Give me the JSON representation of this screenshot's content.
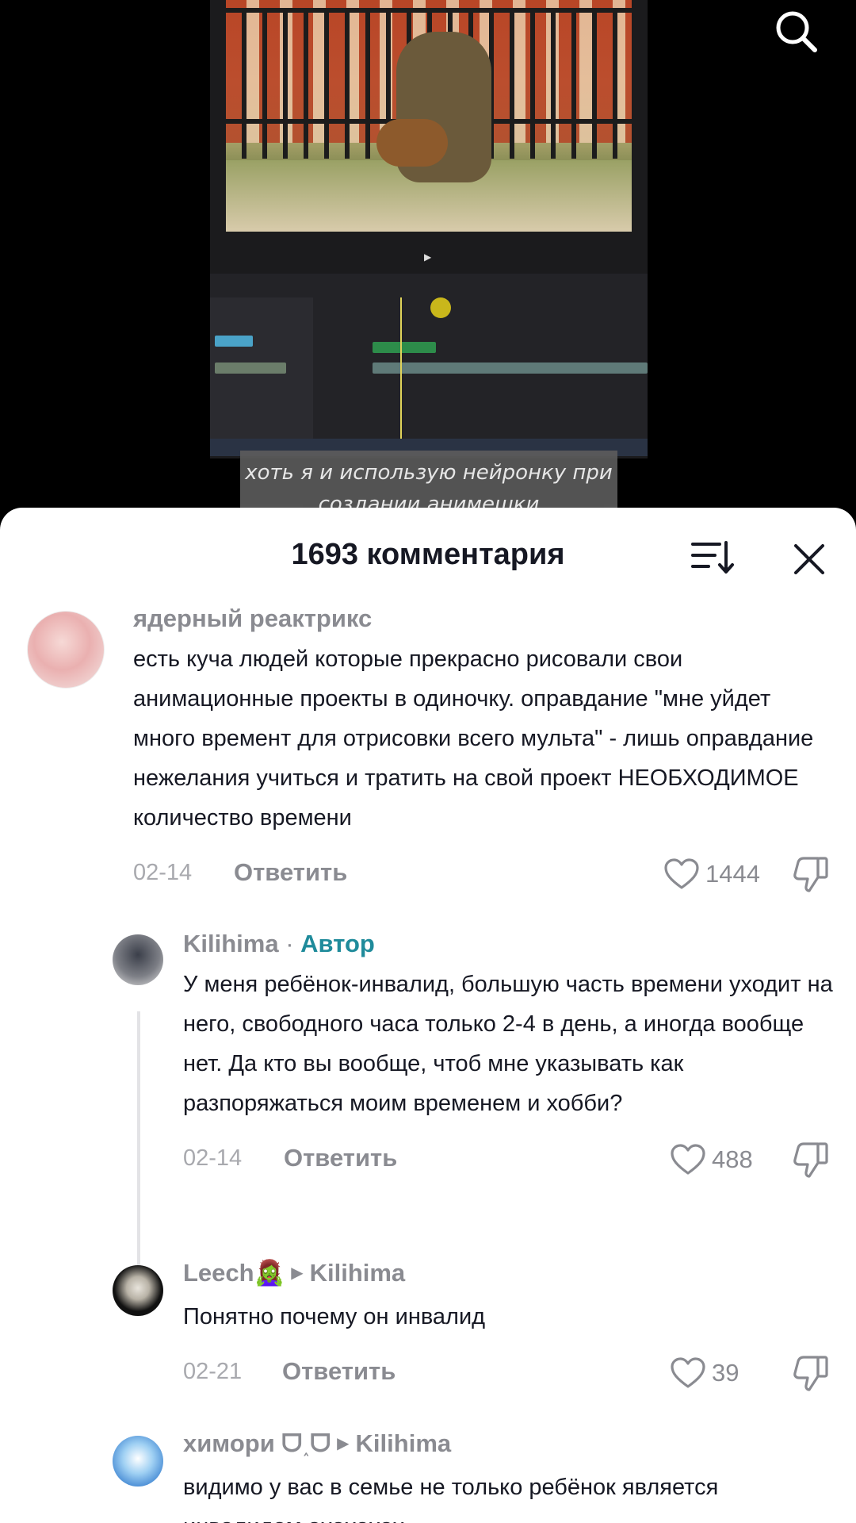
{
  "video": {
    "caption": "хоть я и использую нейронку при создании анимешки",
    "search_icon": "search-icon"
  },
  "sheet": {
    "title": "1693 комментария",
    "sort_icon": "sort-icon",
    "close_icon": "close-icon"
  },
  "comments": [
    {
      "author": "ядерный реактрикс",
      "text": "есть куча людей которые прекрасно рисовали свои анимационные проекты в одиночку. оправдание \"мне уйдет много времент для отрисовки всего мульта\" - лишь оправдание нежелания учиться и тратить на свой проект НЕОБХОДИМОЕ количество времени",
      "date": "02-14",
      "reply_label": "Ответить",
      "likes": "1444"
    },
    {
      "author": "Kilihima",
      "separator": "·",
      "tag": "Автор",
      "text": "У меня ребёнок-инвалид, большую часть времени уходит на него, свободного часа только 2-4 в день, а иногда вообще нет. Да кто вы вообще, чтоб мне указывать как разпоряжаться моим временем и хобби?",
      "date": "02-14",
      "reply_label": "Ответить",
      "likes": "488"
    },
    {
      "author": "Leech🧟‍♀️",
      "reply_to": "Kilihima",
      "text": "Понятно почему он инвалид",
      "date": "02-21",
      "reply_label": "Ответить",
      "likes": "39"
    },
    {
      "author": "химори ᗜ˰ᗜ",
      "reply_to": "Kilihima",
      "text": "видимо у вас в семье не только ребёнок является инвалидом ахахахах"
    }
  ]
}
